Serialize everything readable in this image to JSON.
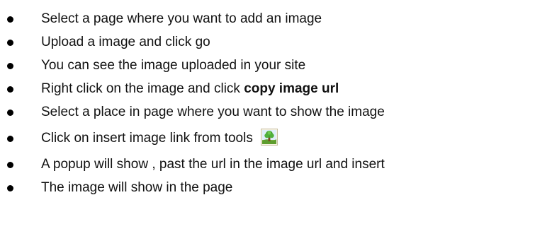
{
  "instructions": {
    "items": [
      {
        "text": "Select a page where you want to add an image"
      },
      {
        "text": "Upload a image and click go"
      },
      {
        "text": "You can see the image uploaded in your site"
      },
      {
        "text": "Right click on the image and click ",
        "bold": "copy image url"
      },
      {
        "text": "Select a place in page where you want to show the image"
      },
      {
        "text": "Click on insert image link from tools",
        "icon": "insert-image-icon"
      },
      {
        "text": "A popup will show , past the url in the image url and insert"
      },
      {
        "text": "The image will show in the page"
      }
    ]
  }
}
